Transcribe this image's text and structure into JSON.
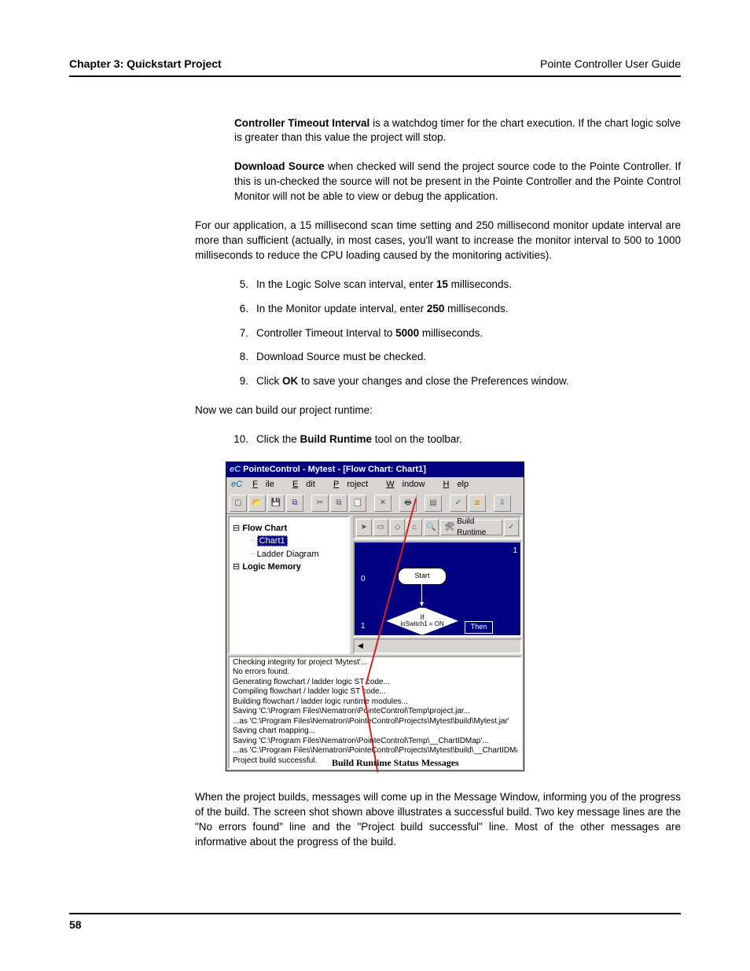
{
  "header": {
    "chapter": "Chapter 3: Quickstart Project",
    "guide": "Pointe Controller User Guide"
  },
  "defs": {
    "cti_label": "Controller Timeout Interval",
    "cti_text": " is a watchdog timer for the chart execution. If the chart logic solve is greater than this value the project will stop.",
    "ds_label": "Download Source",
    "ds_text": " when checked will send the project source code to the Pointe Controller. If this is un-checked the source will not be present in the Pointe Controller and the Pointe Control Monitor will not be able to view or debug the application."
  },
  "para_app_settings": "For our application, a 15 millisecond scan time setting and 250 millisecond monitor update interval are more than sufficient (actually, in most cases, you'll want to increase the monitor interval to 500 to 1000 milliseconds to reduce the CPU loading caused by the monitoring activities).",
  "steps1": [
    {
      "n": "5.",
      "pre": "In the Logic Solve scan interval, enter ",
      "bold": "15",
      "post": " milliseconds."
    },
    {
      "n": "6.",
      "pre": "In the Monitor update interval, enter ",
      "bold": "250",
      "post": " milliseconds."
    },
    {
      "n": "7.",
      "pre": "Controller Timeout Interval to ",
      "bold": "5000",
      "post": " milliseconds."
    },
    {
      "n": "8.",
      "pre": "Download Source must be checked.",
      "bold": "",
      "post": ""
    },
    {
      "n": "9.",
      "pre": "Click ",
      "bold": "OK",
      "post": " to save your changes and close the Preferences window."
    }
  ],
  "para_now_build": "Now we can build our project runtime:",
  "step10": {
    "n": "10.",
    "pre": "Click the ",
    "bold": "Build Runtime",
    "post": " tool on the toolbar."
  },
  "screenshot": {
    "title": "PointeControl - Mytest - [Flow Chart: Chart1]",
    "logo": "eC",
    "menubar": {
      "file": "File",
      "edit": "Edit",
      "project": "Project",
      "window": "Window",
      "help": "Help"
    },
    "tree": {
      "root1": "Flow Chart",
      "chart1": "Chart1",
      "ladder": "Ladder Diagram",
      "root2": "Logic Memory"
    },
    "toolbar2_button": "Build Runtime",
    "flow": {
      "row_a": "0",
      "row_b": "1",
      "col_end": "1",
      "start": "Start",
      "if": "If",
      "cond": "inSwitch1 = ON",
      "then": "Then"
    },
    "output_lines": [
      "Checking integrity for project 'Mytest'...",
      "No errors found.",
      "Generating flowchart / ladder logic ST code...",
      "Compiling flowchart / ladder logic ST code...",
      "Building flowchart / ladder logic runtime modules...",
      "Saving 'C:\\Program Files\\Nematron\\PointeControl\\Temp\\project.jar...",
      "...as 'C:\\Program Files\\Nematron\\PointeControl\\Projects\\Mytest\\build\\Mytest.jar'",
      "Saving chart mapping...",
      "Saving 'C:\\Program Files\\Nematron\\PointeControl\\Temp\\__ChartIDMap'...",
      "...as 'C:\\Program Files\\Nematron\\PointeControl\\Projects\\Mytest\\build\\__ChartIDMap'",
      "Project build successful."
    ],
    "callout": "Build Runtime Status Messages"
  },
  "para_build_result": "When the project builds, messages will come up in the Message Window, informing you of the progress of the build. The screen shot shown above illustrates a successful build. Two key message lines are the \"No errors found\" line and the \"Project build successful\" line. Most of the other messages are informative about the progress of the build.",
  "page_number": "58"
}
